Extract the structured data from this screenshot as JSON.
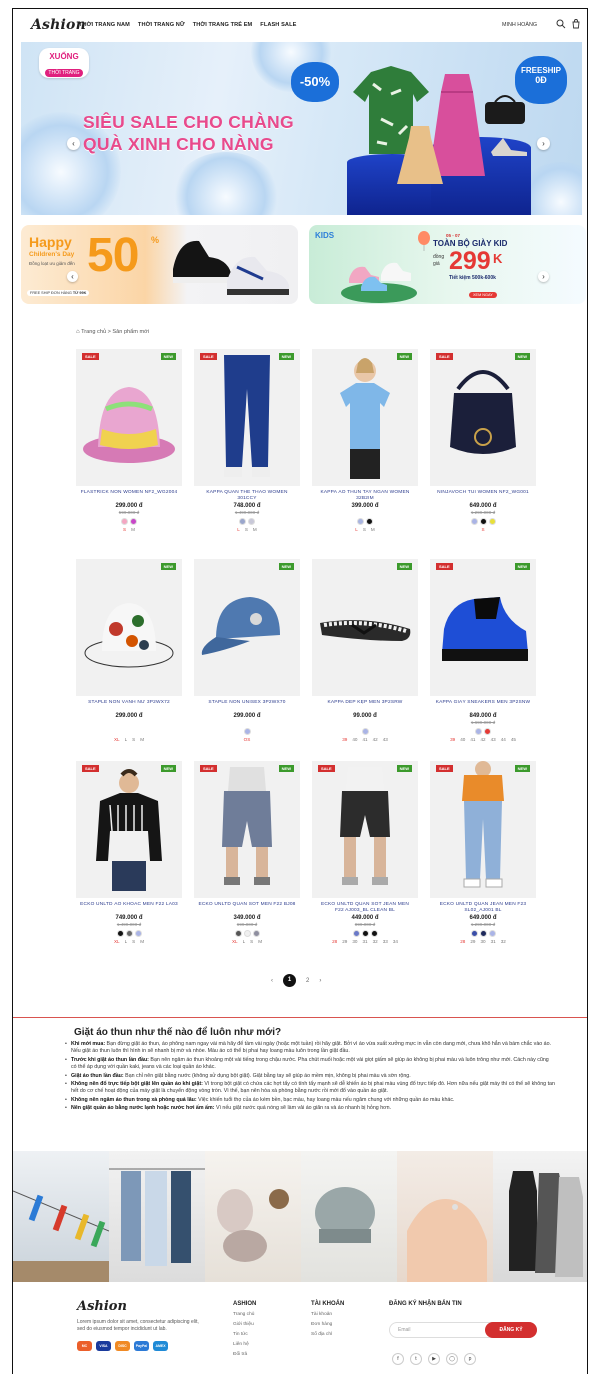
{
  "header": {
    "logo": "Ashion",
    "nav": [
      "THỜI TRANG NAM",
      "THỜI TRANG NỮ",
      "THỜI TRANG TRẺ EM",
      "FLASH SALE"
    ],
    "user": "MINH HOÀNG"
  },
  "hero": {
    "badge_top": "XUỐNG",
    "badge_bottom": "THỜI TRANG",
    "line1": "SIÊU SALE CHO CHÀNG",
    "line2": "QUÀ XINH CHO NÀNG",
    "discount": "-50%",
    "freeship1": "FREESHIP",
    "freeship2": "0Đ"
  },
  "banner_left": {
    "line1": "Happy",
    "line2": "Children's Day",
    "line3": "Đồng loạt ưu giảm đến",
    "big": "50",
    "pct": "%",
    "foot1": "FREE SHIP ĐƠN HÀNG",
    "foot2": "TỪ 99K"
  },
  "banner_right": {
    "kids": "KIDS",
    "date": "05 - 07",
    "title": "TOÀN BỘ GIÀY KID",
    "dong": "đồng",
    "gia": "giá",
    "price": "299",
    "k": "K",
    "save": "Tiết kiệm 500k-600k",
    "cta": "XEM NGAY"
  },
  "breadcrumb": "Trang chủ > Sản phẩm mới",
  "labels": {
    "sale": "SALE",
    "new": "NEW"
  },
  "products": [
    {
      "name": "FLASTRICK NON WOMEN NF2_WG2004",
      "price": "299.000 đ",
      "old": "599.000 đ",
      "swatches": [
        "#f4a6c2",
        "#c847c8"
      ],
      "sizes": [
        "S",
        "M"
      ],
      "sale": true,
      "new": true
    },
    {
      "name": "KAPPA QUẦN THỂ THAO WOMEN 301CCY",
      "price": "748.000 đ",
      "old": "1.499.000 đ",
      "swatches": [
        "#9aa6cc",
        "#c8c8d8"
      ],
      "sizes": [
        "L",
        "S",
        "M"
      ],
      "sale": true,
      "new": true
    },
    {
      "name": "KAPPA ÁO THUN TAY NGẮN WOMEN 32B2IM",
      "price": "399.000 đ",
      "old": "",
      "swatches": [
        "#a8b4e0",
        "#111111"
      ],
      "sizes": [
        "L",
        "S",
        "M"
      ],
      "sale": false,
      "new": true
    },
    {
      "name": "NINJAVOCH TÚI WOMEN NF2_WG001",
      "price": "649.000 đ",
      "old": "1.299.000 đ",
      "swatches": [
        "#aab4e6",
        "#111111",
        "#e8e03a"
      ],
      "sizes": [
        "S"
      ],
      "sale": true,
      "new": true
    },
    {
      "name": "STAPLE NÓN VÀNH NỮ 3P2WX72",
      "price": "299.000 đ",
      "old": "",
      "swatches": [],
      "sizes": [
        "XL",
        "L",
        "S",
        "M"
      ],
      "sale": false,
      "new": true
    },
    {
      "name": "STAPLE NÓN UNISEX 3P2WX70",
      "price": "299.000 đ",
      "old": "",
      "swatches": [
        "#aab4e6"
      ],
      "sizes": [
        "OS"
      ],
      "sale": false,
      "new": true
    },
    {
      "name": "KAPPA DÉP KẸP MEN 3P2SRW",
      "price": "99.000 đ",
      "old": "",
      "swatches": [
        "#aab4e6"
      ],
      "sizes": [
        "39",
        "40",
        "41",
        "42",
        "43"
      ],
      "sale": false,
      "new": true
    },
    {
      "name": "KAPPA GIÀY SNEAKERS MEN 3P2SNW",
      "price": "849.000 đ",
      "old": "1.699.000 đ",
      "swatches": [
        "#aab4e6",
        "#e53935"
      ],
      "sizes": [
        "39",
        "40",
        "41",
        "42",
        "43",
        "44",
        "45"
      ],
      "sale": true,
      "new": true
    },
    {
      "name": "ECKO UNLTD ÁO KHOÁC MEN F22 LA03",
      "price": "749.000 đ",
      "old": "1.499.000 đ",
      "swatches": [
        "#111111",
        "#666666",
        "#aab4e6"
      ],
      "sizes": [
        "XL",
        "L",
        "S",
        "M"
      ],
      "sale": true,
      "new": true
    },
    {
      "name": "ECKO UNLTD QUẦN SOT MEN F22 BJ08",
      "price": "349.000 đ",
      "old": "699.000 đ",
      "swatches": [
        "#555555",
        "#f0f0f0",
        "#8f8fa0"
      ],
      "sizes": [
        "XL",
        "L",
        "S",
        "M"
      ],
      "sale": true,
      "new": true
    },
    {
      "name": "ECKO UNLTD QUẦN SOT JEAN MEN F22 AJ003_BL CLEAN BL",
      "price": "449.000 đ",
      "old": "899.000 đ",
      "swatches": [
        "#6a79c8",
        "#111111",
        "#111111"
      ],
      "sizes": [
        "28",
        "29",
        "30",
        "31",
        "32",
        "33",
        "34"
      ],
      "sale": true,
      "new": true
    },
    {
      "name": "ECKO UNLTD QUẦN JEAN MEN F23 SL02_AJ001 BL",
      "price": "649.000 đ",
      "old": "1.299.000 đ",
      "swatches": [
        "#3a4ea8",
        "#1f2a5c",
        "#aab4e6"
      ],
      "sizes": [
        "28",
        "29",
        "30",
        "31",
        "32"
      ],
      "sale": true,
      "new": true
    }
  ],
  "pagination": {
    "prev": "‹",
    "pages": [
      "1",
      "2"
    ],
    "next": "›"
  },
  "article": {
    "title": "Giặt áo thun như thế nào để luôn như mới?",
    "items": [
      {
        "b": "Khi mới mua:",
        "t": " Bạn đừng giặt áo thun, áo phông nam ngay vài mà hãy để tầm vài ngày (hoặc một tuần) rồi hãy giặt. Bởi vì áo vừa xuất xưởng mực in vẫn còn dang mới, chưa khô hẳn và bám chắc vào áo. Nếu giặt áo thun luôn thì hình in sẽ nhanh bị mờ và nhòe. Màu áo có thể bị phai hay loang màu luôn trong lần giặt đầu."
      },
      {
        "b": "Trước khi giặt áo thun lần đầu:",
        "t": " Bạn nên ngâm áo thun khoảng một vài tiếng trong chậu nước. Pha chút muối hoặc một vài giọt giấm sẽ giúp áo không bị phai màu và luôn trông như mới. Cách này cũng có thể áp dụng với quần kaki, jeans và các loại quần áo khác."
      },
      {
        "b": "Giặt áo thun lần đầu:",
        "t": " Bạn chỉ nên giặt bằng nước (không sử dụng bột giặt). Giặt bằng tay sẽ giúp áo mềm mịn, không bị phai màu và sờn rộng."
      },
      {
        "b": "Không nên đổ trực tiếp bột giặt lên quần áo khi giặt:",
        "t": " Vì trong bột giặt có chứa các hợt tẩy có tính tẩy mạnh sẽ dễ khiến áo bị phai màu vùng đổ trực tiếp đó. Hơn nữa nếu giặt máy thì có thể sẽ không tan hết do cơ chế hoạt động của máy giặt là chuyển động vòng tròn. Vì thế, bạn nên hòa xà phòng bằng nước rồi mới đổ vào quần áo giặt."
      },
      {
        "b": "Không nên ngâm áo thun trong xà phòng quá lâu:",
        "t": " Việc khiến tuổi thọ của áo kém bền, bạc màu, hay loang màu nếu ngâm chung với những quần áo màu khác."
      },
      {
        "b": "Nên giặt quần áo bằng nước lạnh hoặc nước hơi ấm ấm:",
        "t": " Vì nếu giặt nước quá nóng sẽ làm vải áo giãn ra và áo nhanh bị hỏng hơn."
      }
    ]
  },
  "footer": {
    "logo": "Ashion",
    "desc": "Lorem ipsum dolor sit amet, consectetur adipiscing elit, sed do eiusmod tempor incididunt ut lab.",
    "col1": {
      "title": "ASHION",
      "items": [
        "Trang chủ",
        "Giới thiệu",
        "Tin tức",
        "Liên hệ",
        "Đổi trả"
      ]
    },
    "col2": {
      "title": "TÀI KHOẢN",
      "items": [
        "Tài khoản",
        "Đơn hàng",
        "Sổ địa chỉ"
      ]
    },
    "col3": {
      "title": "ĐĂNG KÝ NHẬN BẢN TIN"
    },
    "email_placeholder": "Email",
    "subscribe": "ĐĂNG KÝ",
    "payments": [
      "MC",
      "VISA",
      "DISC",
      "PayPal",
      "AMEX"
    ]
  }
}
